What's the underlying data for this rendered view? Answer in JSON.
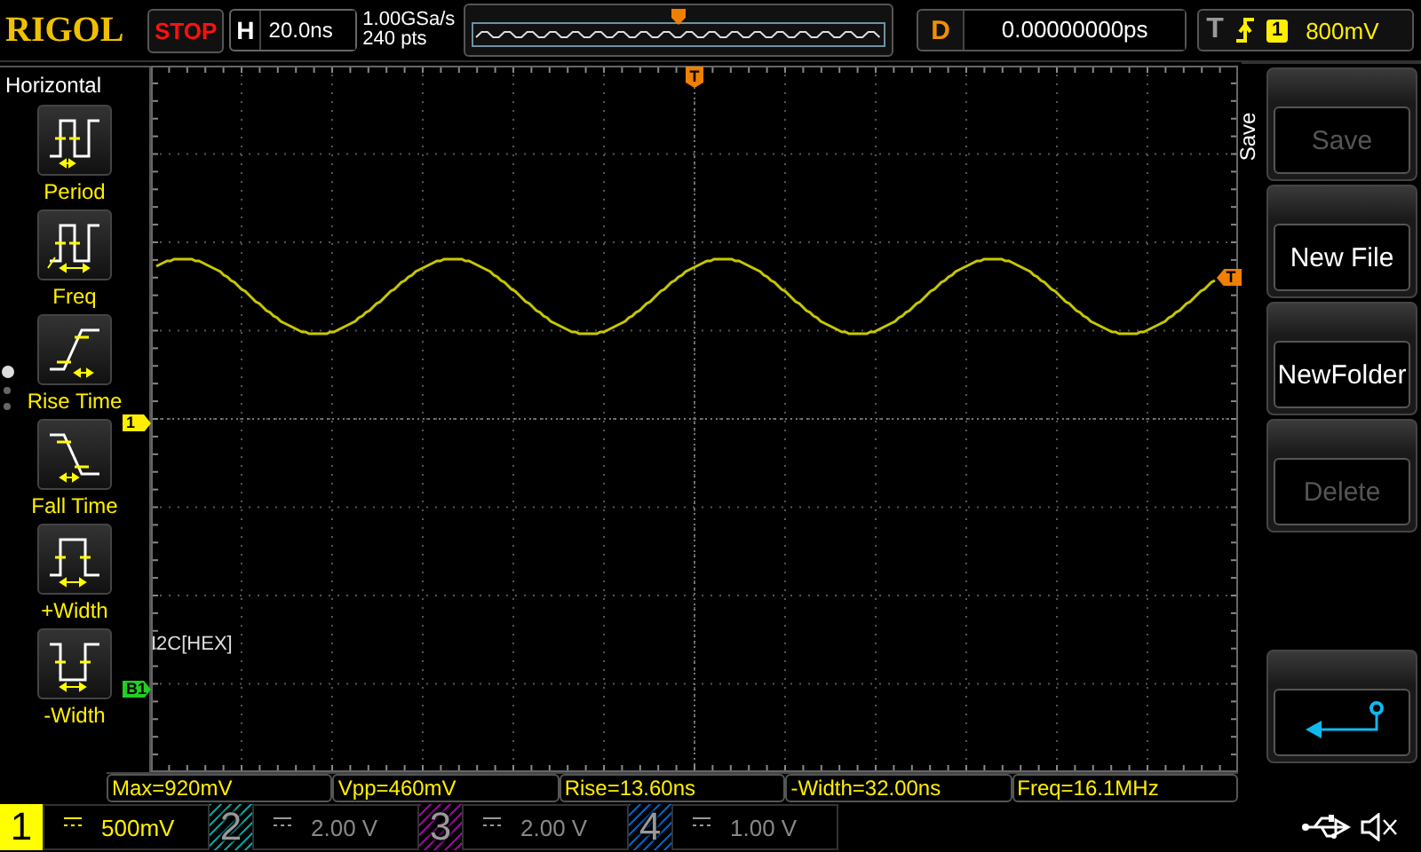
{
  "logo": "RIGOL",
  "run_state": {
    "label": "STOP"
  },
  "horizontal": {
    "label": "H",
    "timebase": "20.0ns"
  },
  "acquisition": {
    "sample_rate": "1.00GSa/s",
    "memory_depth": "240 pts"
  },
  "delay": {
    "label": "D",
    "value": "0.00000000ps"
  },
  "trigger": {
    "label": "T",
    "source": "1",
    "level": "800mV"
  },
  "left_menu": {
    "title": "Horizontal",
    "items": [
      {
        "label": "Period",
        "kind": "period"
      },
      {
        "label": "Freq",
        "kind": "freq"
      },
      {
        "label": "Rise Time",
        "kind": "rise"
      },
      {
        "label": "Fall Time",
        "kind": "fall"
      },
      {
        "label": "+Width",
        "kind": "pwidth"
      },
      {
        "label": "-Width",
        "kind": "nwidth"
      }
    ],
    "pages": [
      {
        "selected": true
      },
      {
        "selected": false
      },
      {
        "selected": false
      }
    ]
  },
  "grid": {
    "trigger_position_marker": "T",
    "trigger_level_marker": "T",
    "channel_marker": "1",
    "bus_label": "I2C[HEX]",
    "bus_marker": "B1"
  },
  "right_menu": {
    "title": "Save",
    "buttons": [
      {
        "kind": "text",
        "label": "Save",
        "disabled": true
      },
      {
        "kind": "text",
        "label": "New File",
        "disabled": false
      },
      {
        "kind": "text",
        "label": "NewFolder",
        "disabled": false
      },
      {
        "kind": "text",
        "label": "Delete",
        "disabled": true
      },
      {
        "kind": "return"
      }
    ]
  },
  "measurements": [
    "Max=920mV",
    "Vpp=460mV",
    "Rise=13.60ns",
    "-Width=32.00ns",
    "Freq=16.1MHz"
  ],
  "channels": [
    {
      "number": "1",
      "scale": "500mV",
      "on": true,
      "color": "#ffff00"
    },
    {
      "number": "2",
      "scale": "2.00 V",
      "on": false,
      "color": "#00a0a0"
    },
    {
      "number": "3",
      "scale": "2.00 V",
      "on": false,
      "color": "#a000a0"
    },
    {
      "number": "4",
      "scale": "1.00 V",
      "on": false,
      "color": "#0060c0"
    }
  ]
}
